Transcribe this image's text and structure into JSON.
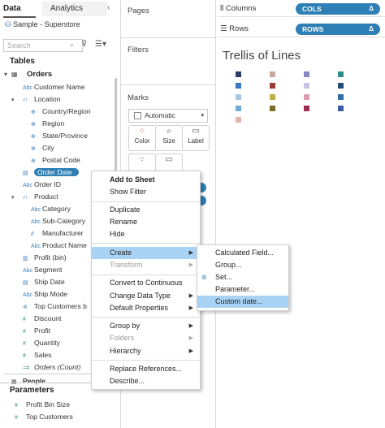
{
  "tabs": {
    "data": "Data",
    "analytics": "Analytics"
  },
  "datasource": "Sample - Superstore",
  "search_placeholder": "Search",
  "tables_header": "Tables",
  "orders_header": "Orders",
  "fields": {
    "customer_name": "Customer Name",
    "location": "Location",
    "country_region": "Country/Region",
    "region": "Region",
    "state_province": "State/Province",
    "city": "City",
    "postal_code": "Postal Code",
    "order_date": "Order Date",
    "order_id": "Order ID",
    "product": "Product",
    "category": "Category",
    "sub_category": "Sub-Category",
    "manufacturer": "Manufacturer",
    "product_name": "Product Name",
    "profit_bin": "Profit (bin)",
    "segment": "Segment",
    "ship_date": "Ship Date",
    "ship_mode": "Ship Mode",
    "top_customers_by": "Top Customers b",
    "discount": "Discount",
    "profit": "Profit",
    "quantity": "Quantity",
    "sales": "Sales",
    "orders_count": "Orders (Count)",
    "people": "People"
  },
  "parameters_header": "Parameters",
  "parameters": {
    "profit_bin_size": "Profit Bin Size",
    "top_customers": "Top Customers"
  },
  "cards": {
    "pages": "Pages",
    "filters": "Filters",
    "marks": "Marks",
    "marks_type": "Automatic"
  },
  "mark_buttons": {
    "color": "Color",
    "size": "Size",
    "label": "Label"
  },
  "shelves": {
    "columns": "Columns",
    "rows": "Rows",
    "columns_pill": "COLS",
    "rows_pill": "ROWS",
    "delta": "Δ"
  },
  "sheet_title": "Trellis of Lines",
  "colors": {
    "swatches": [
      "#2b3a67",
      "#c9a99f",
      "#8a86c4",
      "#2c8c8a",
      "#3a76c2",
      "#9b3a3a",
      "#c6c3e6",
      "#1f4f7a",
      "#a9c8e8",
      "#bfae47",
      "#d99bb0",
      "#2f6fa8",
      "#6ea9d8",
      "#7c6d2a",
      "#9e2e54",
      "#3a5fa0",
      "#e3b5b0"
    ],
    "accent": "#2e7fb5"
  },
  "context_menu": {
    "add_to_sheet": "Add to Sheet",
    "show_filter": "Show Filter",
    "duplicate": "Duplicate",
    "rename": "Rename",
    "hide": "Hide",
    "create": "Create",
    "transform": "Transform",
    "convert_to_continuous": "Convert to Continuous",
    "change_data_type": "Change Data Type",
    "default_properties": "Default Properties",
    "group_by": "Group by",
    "folders": "Folders",
    "hierarchy": "Hierarchy",
    "replace_references": "Replace References...",
    "describe": "Describe..."
  },
  "create_submenu": {
    "calculated_field": "Calculated Field...",
    "group": "Group...",
    "set": "Set...",
    "parameter": "Parameter...",
    "custom_date": "Custom date..."
  }
}
